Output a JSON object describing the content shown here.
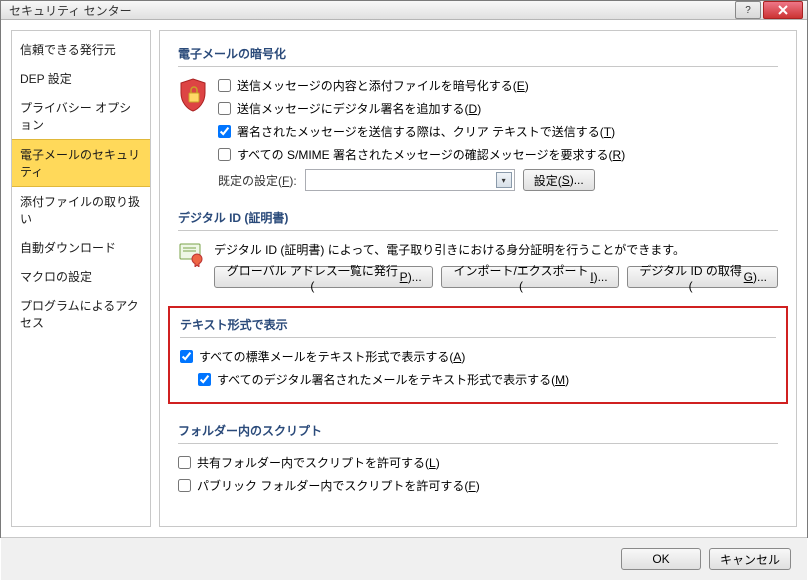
{
  "window": {
    "title": "セキュリティ センター"
  },
  "sidebar": {
    "items": [
      {
        "label": "信頼できる発行元"
      },
      {
        "label": "DEP 設定"
      },
      {
        "label": "プライバシー オプション"
      },
      {
        "label": "電子メールのセキュリティ",
        "selected": true
      },
      {
        "label": "添付ファイルの取り扱い"
      },
      {
        "label": "自動ダウンロード"
      },
      {
        "label": "マクロの設定"
      },
      {
        "label": "プログラムによるアクセス"
      }
    ]
  },
  "groups": {
    "encryption": {
      "title": "電子メールの暗号化",
      "opts": {
        "encrypt": {
          "label_pre": "送信メッセージの内容と添付ファイルを暗号化する(",
          "accel": "E",
          "label_post": ")",
          "checked": false
        },
        "sign": {
          "label_pre": "送信メッセージにデジタル署名を追加する(",
          "accel": "D",
          "label_post": ")",
          "checked": false
        },
        "cleartext": {
          "label_pre": "署名されたメッセージを送信する際は、クリア テキストで送信する(",
          "accel": "T",
          "label_post": ")",
          "checked": true
        },
        "confirm": {
          "label_pre": "すべての S/MIME 署名されたメッセージの確認メッセージを要求する(",
          "accel": "R",
          "label_post": ")",
          "checked": false
        }
      },
      "default_label_pre": "既定の設定(",
      "default_accel": "F",
      "default_label_post": "):",
      "settings_btn_pre": "設定(",
      "settings_accel": "S",
      "settings_btn_post": ")..."
    },
    "digitalid": {
      "title": "デジタル ID (証明書)",
      "desc": "デジタル ID (証明書) によって、電子取り引きにおける身分証明を行うことができます。",
      "btn_publish_pre": "グローバル アドレス一覧に発行(",
      "btn_publish_accel": "P",
      "btn_publish_post": ")...",
      "btn_import_pre": "インポート/エクスポート(",
      "btn_import_accel": "I",
      "btn_import_post": ")...",
      "btn_get_pre": "デジタル ID の取得(",
      "btn_get_accel": "G",
      "btn_get_post": ")..."
    },
    "textformat": {
      "title": "テキスト形式で表示",
      "opt_all": {
        "label_pre": "すべての標準メールをテキスト形式で表示する(",
        "accel": "A",
        "label_post": ")",
        "checked": true
      },
      "opt_signed": {
        "label_pre": "すべてのデジタル署名されたメールをテキスト形式で表示する(",
        "accel": "M",
        "label_post": ")",
        "checked": true
      }
    },
    "folderscript": {
      "title": "フォルダー内のスクリプト",
      "opt_shared": {
        "label_pre": "共有フォルダー内でスクリプトを許可する(",
        "accel": "L",
        "label_post": ")",
        "checked": false
      },
      "opt_public": {
        "label_pre": "パブリック フォルダー内でスクリプトを許可する(",
        "accel": "F",
        "label_post": ")",
        "checked": false
      }
    }
  },
  "footer": {
    "ok": "OK",
    "cancel": "キャンセル"
  }
}
